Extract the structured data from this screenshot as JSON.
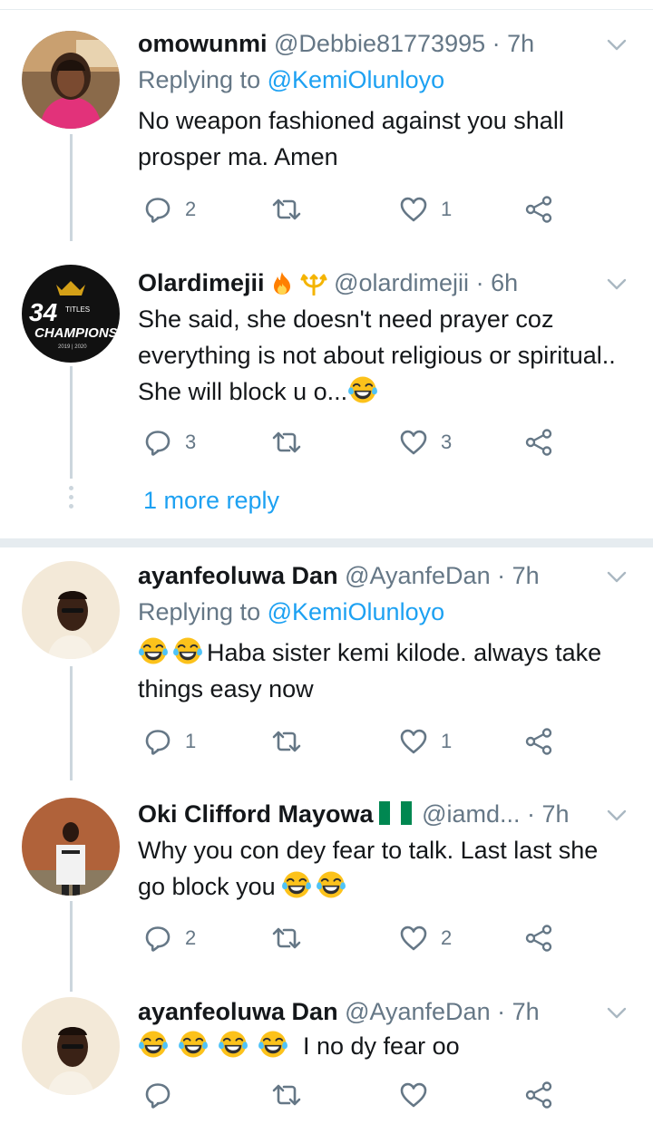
{
  "tweets": [
    {
      "name": "omowunmi",
      "handle": "@Debbie81773995",
      "time": "7h",
      "replying_prefix": "Replying to",
      "replying_to": "@KemiOlunloyo",
      "text": "No weapon fashioned against you shall prosper ma. Amen",
      "replies": "2",
      "retweets": "",
      "likes": "1"
    },
    {
      "name": "Olardimejii",
      "handle": "@olardimejii",
      "time": "6h",
      "avatar_text_top": "34",
      "avatar_text_small": "TITLES",
      "avatar_text_main": "CHAMPIONS",
      "avatar_text_year": "2019 | 2020",
      "text": "She said, she doesn't need prayer coz everything is not about religious or spiritual.. She will block u o...",
      "replies": "3",
      "retweets": "",
      "likes": "3",
      "more_reply": "1 more reply"
    },
    {
      "name": "ayanfeoluwa Dan",
      "handle": "@AyanfeDan",
      "time": "7h",
      "replying_prefix": "Replying to",
      "replying_to": "@KemiOlunloyo",
      "text": "Haba sister kemi kilode. always take things easy now",
      "replies": "1",
      "retweets": "",
      "likes": "1"
    },
    {
      "name": "Oki Clifford Mayowa",
      "handle": "@iamd...",
      "time": "7h",
      "text": "Why you con dey fear to talk. Last last she go block you",
      "replies": "2",
      "retweets": "",
      "likes": "2"
    },
    {
      "name": "ayanfeoluwa Dan",
      "handle": "@AyanfeDan",
      "time": "7h",
      "text": "I no dy fear oo",
      "replies": "",
      "retweets": "",
      "likes": ""
    }
  ],
  "colors": {
    "accent": "#1da1f2",
    "secondary_text": "#657786",
    "divider": "#e6ecf0",
    "thread_line": "#ccd6dd"
  },
  "icons": [
    "reply-icon",
    "retweet-icon",
    "like-icon",
    "share-icon",
    "chevron-down-icon",
    "laughing-emoji-icon",
    "fire-emoji-icon",
    "trident-emoji-icon",
    "nigeria-flag-icon"
  ]
}
